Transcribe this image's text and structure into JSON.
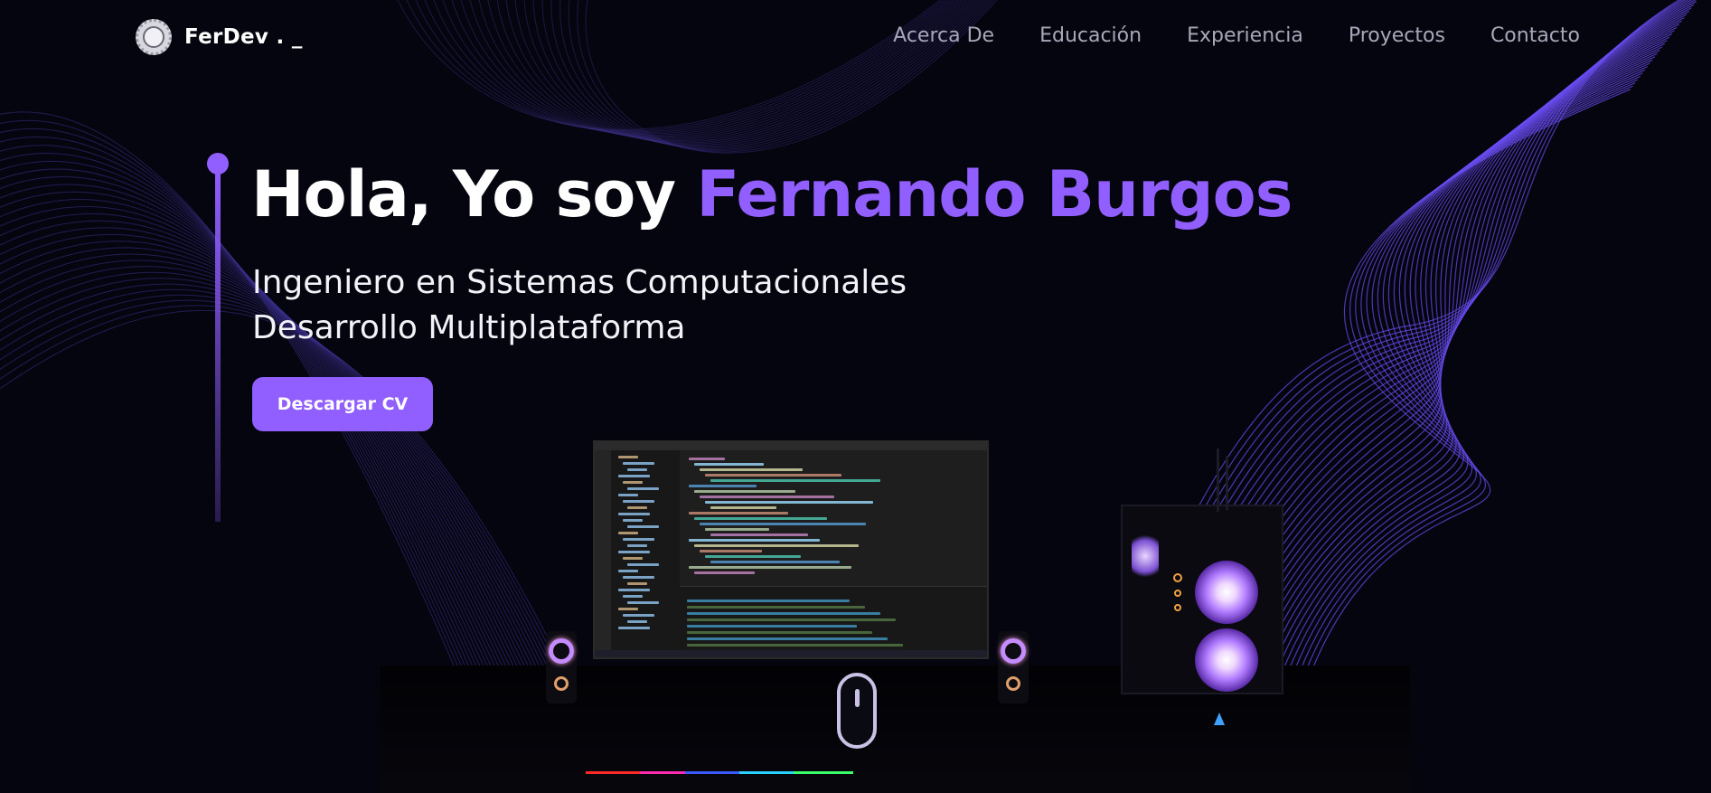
{
  "nav": {
    "logo_text": "FerDev . _",
    "links": [
      {
        "label": "Acerca De"
      },
      {
        "label": "Educación"
      },
      {
        "label": "Experiencia"
      },
      {
        "label": "Proyectos"
      },
      {
        "label": "Contacto"
      }
    ]
  },
  "hero": {
    "greeting": "Hola, Yo soy ",
    "name": "Fernando Burgos",
    "subtitle_line1": "Ingeniero en Sistemas Computacionales",
    "subtitle_line2": "Desarrollo Multiplataforma",
    "cta_label": "Descargar CV"
  },
  "colors": {
    "background": "#050510",
    "accent": "#915eff",
    "nav_text": "#a7a7b9",
    "text": "#ffffff"
  },
  "scene": {
    "description_icons": [
      "monitor-icon",
      "speaker-icon",
      "pc-tower-icon",
      "mouse-icon",
      "keyboard-icon"
    ]
  }
}
